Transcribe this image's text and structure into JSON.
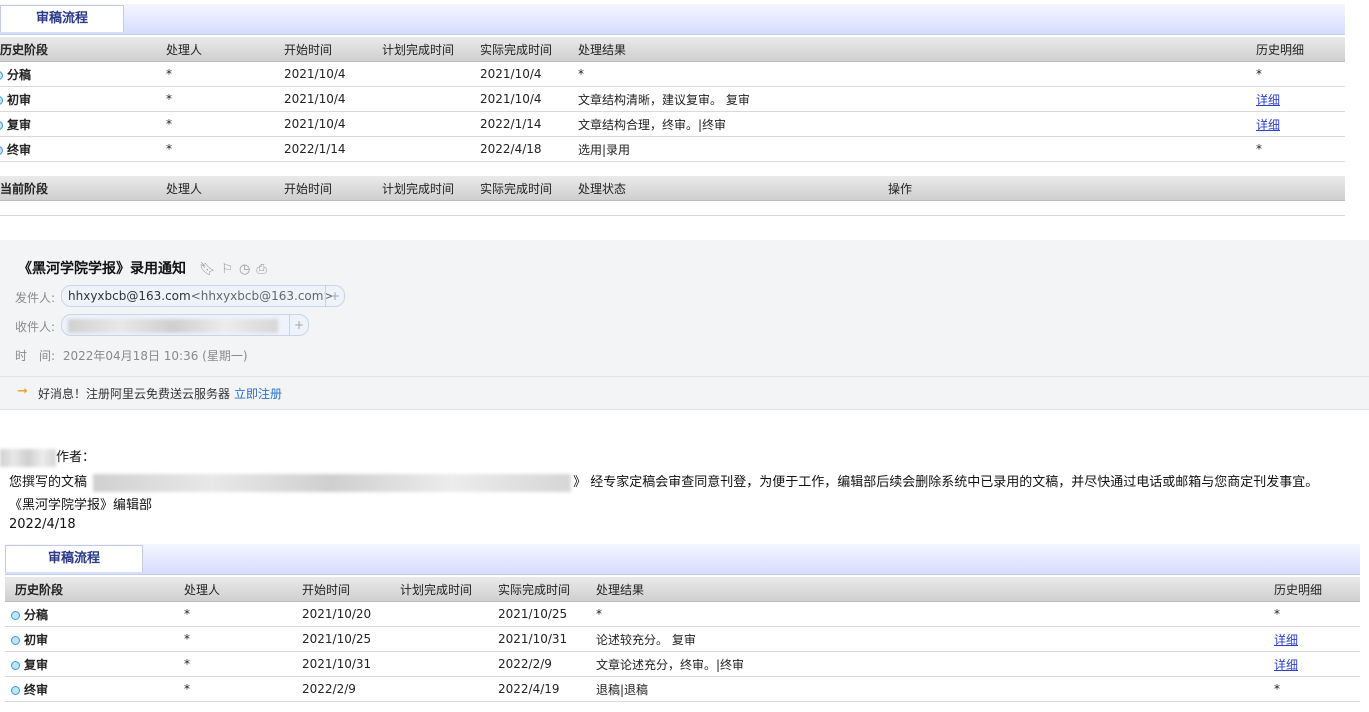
{
  "top": {
    "tab_label": "审稿流程",
    "history_headers": [
      "历史阶段",
      "处理人",
      "开始时间",
      "计划完成时间",
      "实际完成时间",
      "处理结果",
      "历史明细"
    ],
    "history_rows": [
      {
        "stage": "分稿",
        "handler": "*",
        "start": "2021/10/4",
        "plan": "",
        "actual": "2021/10/4",
        "result": "*",
        "detail": "*",
        "detail_link": false
      },
      {
        "stage": "初审",
        "handler": "*",
        "start": "2021/10/4",
        "plan": "",
        "actual": "2021/10/4",
        "result": "文章结构清晰，建议复审。 复审",
        "detail": "详细",
        "detail_link": true
      },
      {
        "stage": "复审",
        "handler": "*",
        "start": "2021/10/4",
        "plan": "",
        "actual": "2022/1/14",
        "result": "文章结构合理，终审。|终审",
        "detail": "详细",
        "detail_link": true
      },
      {
        "stage": "终审",
        "handler": "*",
        "start": "2022/1/14",
        "plan": "",
        "actual": "2022/4/18",
        "result": "选用|录用",
        "detail": "*",
        "detail_link": false
      }
    ],
    "current_headers": [
      "当前阶段",
      "处理人",
      "开始时间",
      "计划完成时间",
      "实际完成时间",
      "处理状态",
      "操作"
    ]
  },
  "mail": {
    "subject": "《黑河学院学报》录用通知",
    "sender_label": "发件人:",
    "sender_name": "hhxyxbcb@163.com",
    "sender_addr": "<hhxyxbcb@163.com>",
    "recipient_label": "收件人:",
    "time_label": "时　间:",
    "time_value": "2022年04月18日 10:36 (星期一)",
    "promo_text": "好消息！注册阿里云免费送云服务器",
    "promo_link": "立即注册",
    "icons": [
      "bookmark-icon",
      "flag-icon",
      "clock-icon",
      "print-icon"
    ]
  },
  "letter": {
    "greeting": "作者：",
    "line_prefix": "您撰写的文稿",
    "line_suffix": "》 经专家定稿会审查同意刊登，为便于工作，编辑部后续会删除系统中已录用的文稿，并尽快通过电话或邮箱与您商定刊发事宜。",
    "signature": "《黑河学院学报》编辑部",
    "date": "2022/4/18"
  },
  "bottom": {
    "tab_label": "审稿流程",
    "history_headers": [
      "历史阶段",
      "处理人",
      "开始时间",
      "计划完成时间",
      "实际完成时间",
      "处理结果",
      "历史明细"
    ],
    "history_rows": [
      {
        "stage": "分稿",
        "handler": "*",
        "start": "2021/10/20",
        "plan": "",
        "actual": "2021/10/25",
        "result": "*",
        "detail": "*",
        "detail_link": false
      },
      {
        "stage": "初审",
        "handler": "*",
        "start": "2021/10/25",
        "plan": "",
        "actual": "2021/10/31",
        "result": "论述较充分。 复审",
        "detail": "详细",
        "detail_link": true
      },
      {
        "stage": "复审",
        "handler": "*",
        "start": "2021/10/31",
        "plan": "",
        "actual": "2022/2/9",
        "result": "文章论述充分，终审。|终审",
        "detail": "详细",
        "detail_link": true
      },
      {
        "stage": "终审",
        "handler": "*",
        "start": "2022/2/9",
        "plan": "",
        "actual": "2022/4/19",
        "result": "退稿|退稿",
        "detail": "*",
        "detail_link": false
      }
    ]
  }
}
